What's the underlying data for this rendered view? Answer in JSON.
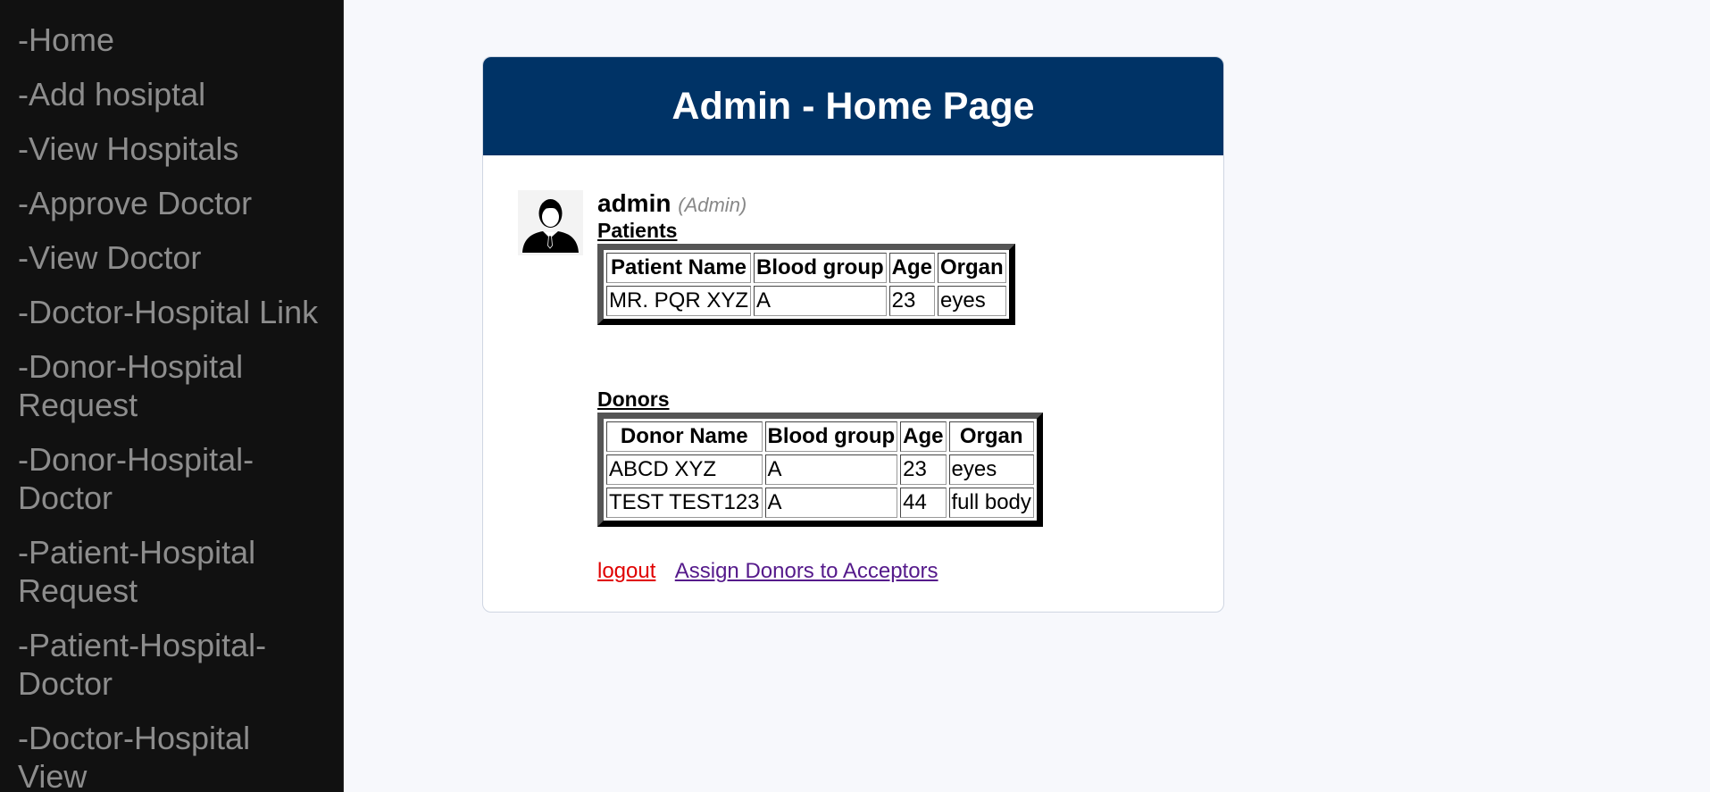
{
  "sidebar": {
    "items": [
      {
        "label": "-Home"
      },
      {
        "label": "-Add hosiptal"
      },
      {
        "label": "-View Hospitals"
      },
      {
        "label": "-Approve Doctor"
      },
      {
        "label": "-View Doctor"
      },
      {
        "label": "-Doctor-Hospital Link"
      },
      {
        "label": "-Donor-Hospital Request"
      },
      {
        "label": "-Donor-Hospital-Doctor"
      },
      {
        "label": "-Patient-Hospital Request"
      },
      {
        "label": "-Patient-Hospital-Doctor"
      },
      {
        "label": "-Doctor-Hospital View"
      }
    ]
  },
  "header": {
    "title": "Admin - Home Page"
  },
  "user": {
    "name": "admin",
    "role": "(Admin)",
    "avatar_icon": "user-avatar-icon"
  },
  "patients": {
    "title": "Patients",
    "columns": [
      "Patient Name",
      "Blood group",
      "Age",
      "Organ"
    ],
    "rows": [
      [
        "MR. PQR XYZ",
        "A",
        "23",
        "eyes"
      ]
    ]
  },
  "donors": {
    "title": "Donors",
    "columns": [
      "Donor Name",
      "Blood group",
      "Age",
      "Organ"
    ],
    "rows": [
      [
        "ABCD XYZ",
        "A",
        "23",
        "eyes"
      ],
      [
        "TEST TEST123",
        "A",
        "44",
        "full body"
      ]
    ]
  },
  "links": {
    "logout": "logout",
    "assign": "Assign Donors to Acceptors"
  },
  "colors": {
    "header_bg": "#003366",
    "sidebar_bg": "#111111",
    "sidebar_text": "#8d8d8d",
    "logout_link": "#e00000",
    "assign_link": "#551a8b"
  }
}
